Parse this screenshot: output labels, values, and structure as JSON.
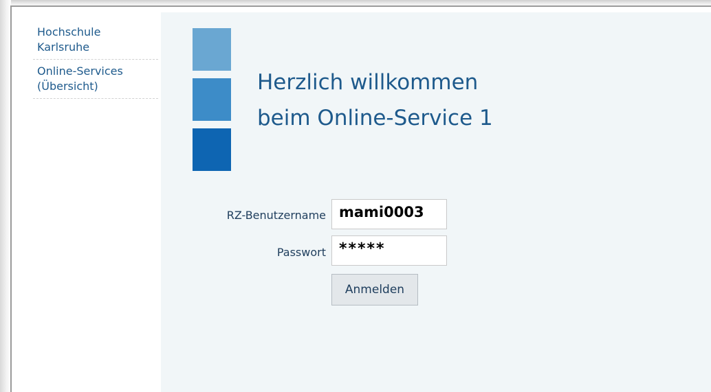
{
  "sidebar": {
    "items": [
      {
        "label": "Hochschule\nKarlsruhe"
      },
      {
        "label": "Online-Services\n(Übersicht)"
      }
    ]
  },
  "main": {
    "title_line1": "Herzlich willkommen",
    "title_line2": "beim Online-Service 1"
  },
  "login_form": {
    "username_label": "RZ-Benutzername",
    "username_value": "mami0003",
    "password_label": "Passwort",
    "password_value": "*****",
    "submit_label": "Anmelden"
  },
  "colors": {
    "accent": "#1e5a8c",
    "panel_background": "#f1f6f8",
    "logo_light": "#6aa7d2",
    "logo_mid": "#3d8cc8",
    "logo_dark": "#0e65b2"
  }
}
